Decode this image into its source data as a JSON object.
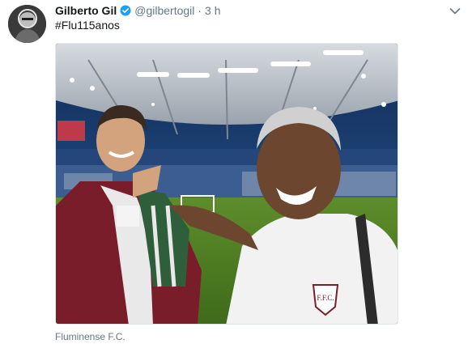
{
  "tweet": {
    "display_name": "Gilberto Gil",
    "handle": "@gilbertogil",
    "separator": "·",
    "time": "3 h",
    "text": "#Flu115anos",
    "photo_caption": "Fluminense F.C.",
    "photo_badge_text": "F.F.C."
  },
  "icons": {
    "verified": "verified-badge-icon",
    "more": "chevron-down-icon"
  },
  "colors": {
    "verified_blue": "#1da1f2",
    "secondary_text": "#657786",
    "primary_text": "#14171a"
  }
}
